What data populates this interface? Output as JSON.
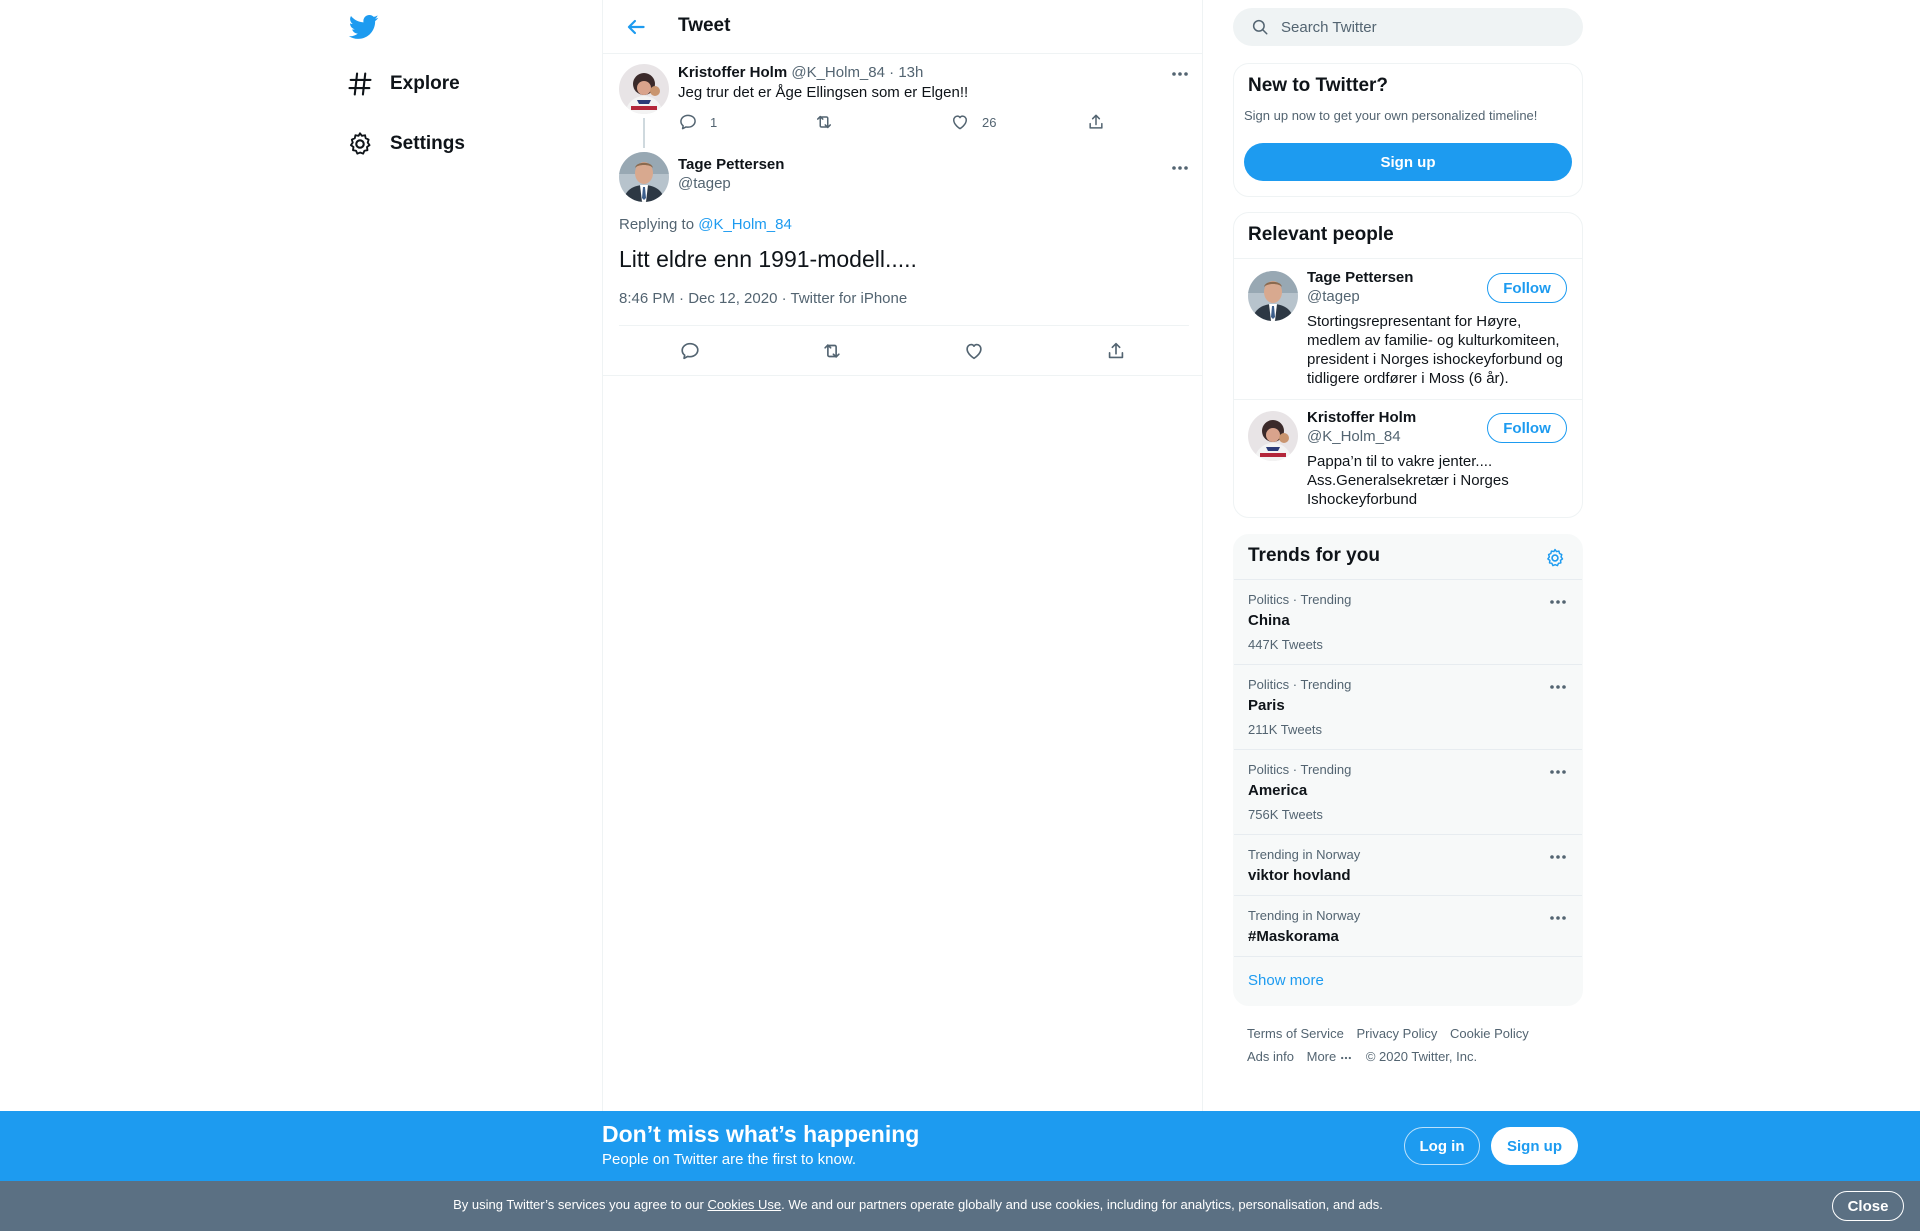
{
  "nav": {
    "items": [
      {
        "label": "Explore"
      },
      {
        "label": "Settings"
      }
    ]
  },
  "header": {
    "title": "Tweet"
  },
  "parent_tweet": {
    "name": "Kristoffer Holm",
    "handle": "@K_Holm_84",
    "separator": " · ",
    "time": "13h",
    "text": "Jeg trur det er Åge Ellingsen som er Elgen!!",
    "replies": "1",
    "likes": "26"
  },
  "main_tweet": {
    "name": "Tage Pettersen",
    "handle": "@tagep",
    "replying_prefix": "Replying to ",
    "replying_to": "@K_Holm_84",
    "text": "Litt eldre enn 1991-modell.....",
    "meta": "8:46 PM · Dec 12, 2020 · Twitter for iPhone"
  },
  "search": {
    "placeholder": "Search Twitter"
  },
  "new_to_twitter": {
    "title": "New to Twitter?",
    "subtitle": "Sign up now to get your own personalized timeline!",
    "signup_label": "Sign up"
  },
  "relevant_people": {
    "title": "Relevant people",
    "people": [
      {
        "name": "Tage Pettersen",
        "handle": "@tagep",
        "bio": "Stortingsrepresentant for Høyre, medlem av familie- og kulturkomiteen, president i Norges ishockeyforbund og tidligere ordfører i Moss (6 år).",
        "follow_label": "Follow"
      },
      {
        "name": "Kristoffer Holm",
        "handle": "@K_Holm_84",
        "bio": "Pappa’n til to vakre jenter.... Ass.Generalsekretær i Norges Ishockeyforbund",
        "follow_label": "Follow"
      }
    ]
  },
  "trends": {
    "title": "Trends for you",
    "items": [
      {
        "context": "Politics · Trending",
        "name": "China",
        "count": "447K Tweets"
      },
      {
        "context": "Politics · Trending",
        "name": "Paris",
        "count": "211K Tweets"
      },
      {
        "context": "Politics · Trending",
        "name": "America",
        "count": "756K Tweets"
      },
      {
        "context": "Trending in Norway",
        "name": "viktor hovland",
        "count": ""
      },
      {
        "context": "Trending in Norway",
        "name": "#Maskorama",
        "count": ""
      }
    ],
    "show_more": "Show more"
  },
  "footer": {
    "links": [
      "Terms of Service",
      "Privacy Policy",
      "Cookie Policy",
      "Ads info",
      "More"
    ],
    "copyright": "© 2020 Twitter, Inc."
  },
  "banner": {
    "title": "Don’t miss what’s happening",
    "subtitle": "People on Twitter are the first to know.",
    "login_label": "Log in",
    "signup_label": "Sign up"
  },
  "cookie": {
    "text_before": "By using Twitter’s services you agree to our ",
    "link": "Cookies Use",
    "text_after": ". We and our partners operate globally and use cookies, including for analytics, personalisation, and ads.",
    "close_label": "Close"
  },
  "colors": {
    "accent": "#1d9bf0",
    "cookie_bar": "#5b7083",
    "muted_text": "#536471"
  },
  "icons": {
    "logo": "twitter-bird-icon",
    "explore": "hashtag-icon",
    "settings": "gear-icon",
    "back": "arrow-left-icon",
    "search": "magnifier-icon",
    "reply": "speech-bubble-icon",
    "retweet": "retweet-arrows-icon",
    "like": "heart-icon",
    "share": "share-upload-icon",
    "more": "ellipsis-icon"
  }
}
